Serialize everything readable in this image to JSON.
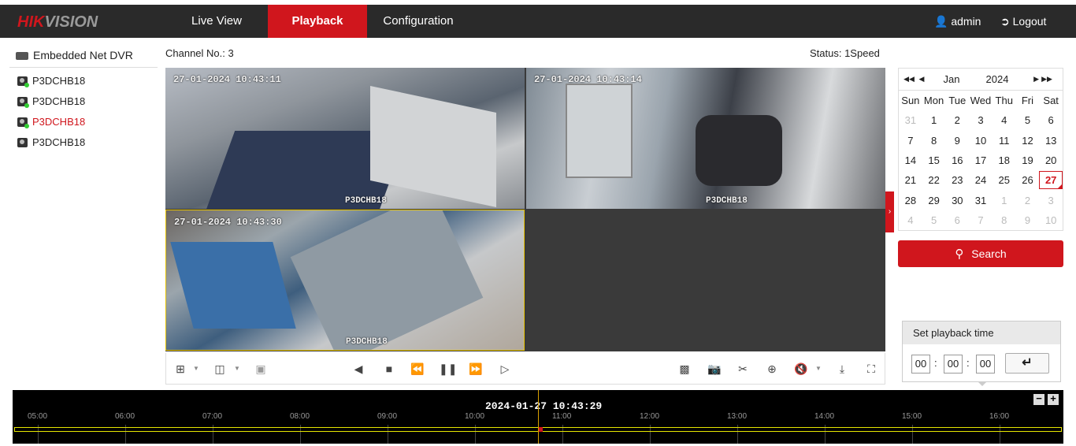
{
  "brand": {
    "hik": "HIK",
    "vision": "VISION"
  },
  "nav": {
    "live_view": "Live View",
    "playback": "Playback",
    "configuration": "Configuration"
  },
  "user": {
    "name": "admin",
    "logout": "Logout"
  },
  "sidebar": {
    "device": "Embedded Net DVR",
    "cameras": [
      {
        "label": "P3DCHB18"
      },
      {
        "label": "P3DCHB18"
      },
      {
        "label": "P3DCHB18",
        "selected": true
      },
      {
        "label": "P3DCHB18"
      }
    ]
  },
  "main": {
    "channel": "Channel No.: 3",
    "status": "Status: 1Speed",
    "tiles": [
      {
        "timestamp": "27-01-2024 10:43:11",
        "name": "P3DCHB18"
      },
      {
        "timestamp": "27-01-2024 10:43:14",
        "name": "P3DCHB18"
      },
      {
        "timestamp": "27-01-2024 10:43:30",
        "name": "P3DCHB18"
      }
    ]
  },
  "calendar": {
    "month": "Jan",
    "year": "2024",
    "weekdays": [
      "Sun",
      "Mon",
      "Tue",
      "Wed",
      "Thu",
      "Fri",
      "Sat"
    ],
    "weeks": [
      [
        "31",
        "1",
        "2",
        "3",
        "4",
        "5",
        "6"
      ],
      [
        "7",
        "8",
        "9",
        "10",
        "11",
        "12",
        "13"
      ],
      [
        "14",
        "15",
        "16",
        "17",
        "18",
        "19",
        "20"
      ],
      [
        "21",
        "22",
        "23",
        "24",
        "25",
        "26",
        "27"
      ],
      [
        "28",
        "29",
        "30",
        "31",
        "1",
        "2",
        "3"
      ],
      [
        "4",
        "5",
        "6",
        "7",
        "8",
        "9",
        "10"
      ]
    ],
    "selected_day": "27"
  },
  "search_label": "Search",
  "playback_time": {
    "title": "Set playback time",
    "hh": "00",
    "mm": "00",
    "ss": "00"
  },
  "timeline": {
    "current": "2024-01-27 10:43:29",
    "hours": [
      "05:00",
      "06:00",
      "07:00",
      "08:00",
      "09:00",
      "10:00",
      "11:00",
      "12:00",
      "13:00",
      "14:00",
      "15:00",
      "16:00"
    ]
  },
  "colors": {
    "accent": "#d0161d",
    "topbar": "#2a2a2a",
    "selection": "#e6c200"
  }
}
